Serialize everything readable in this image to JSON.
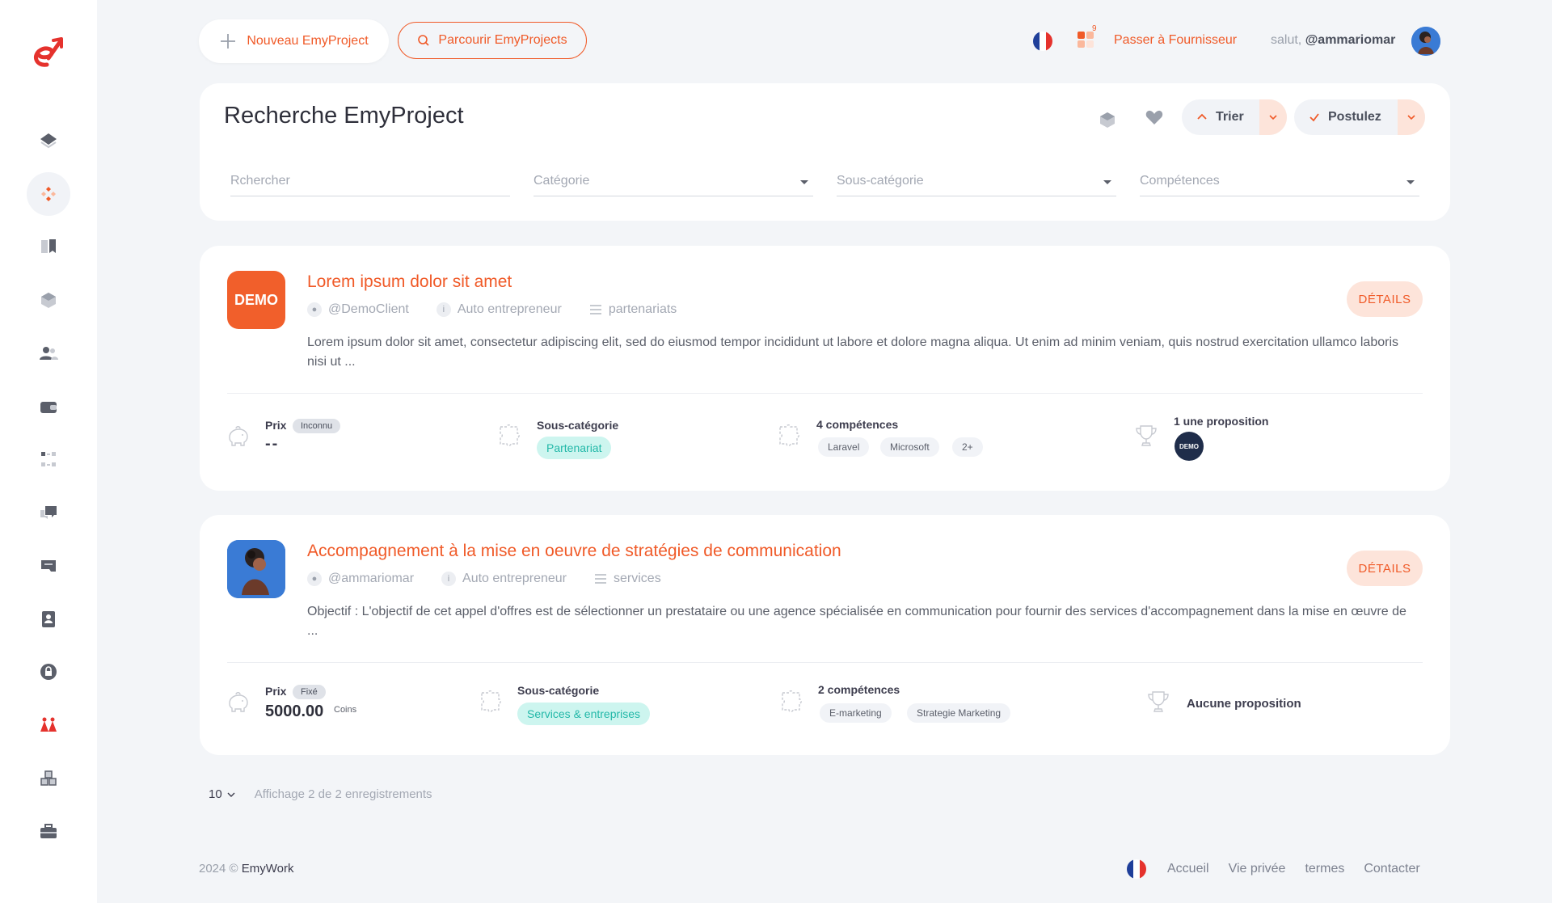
{
  "topbar": {
    "new_project": "Nouveau EmyProject",
    "browse_projects": "Parcourir EmyProjects",
    "notif_count": "9",
    "switch_link": "Passer à Fournisseur",
    "greeting": "salut,",
    "username": "@ammariomar"
  },
  "search": {
    "title": "Recherche EmyProject",
    "sort_label": "Trier",
    "apply_label": "Postulez",
    "search_placeholder": "Rchercher",
    "category_placeholder": "Catégorie",
    "subcategory_placeholder": "Sous-catégorie",
    "skills_placeholder": "Compétences"
  },
  "projects": [
    {
      "logo_text": "DEMO",
      "title": "Lorem ipsum dolor sit amet",
      "client": "@DemoClient",
      "client_type": "Auto entrepreneur",
      "category": "partenariats",
      "description": "Lorem ipsum dolor sit amet, consectetur adipiscing elit, sed do eiusmod tempor incididunt ut labore et dolore magna aliqua. Ut enim ad minim veniam, quis nostrud exercitation ullamco laboris nisi ut ...",
      "details_label": "DÉTAILS",
      "price_label": "Prix",
      "price_badge": "Inconnu",
      "price_value": "--",
      "subcategory_label": "Sous-catégorie",
      "subcategory_value": "Partenariat",
      "skills_label": "4 compétences",
      "skills": [
        "Laravel",
        "Microsoft",
        "2+"
      ],
      "proposals_label": "1 une proposition",
      "proposal_avatar": "DEMO"
    },
    {
      "title": "Accompagnement à la mise en oeuvre de stratégies de communication",
      "client": "@ammariomar",
      "client_type": "Auto entrepreneur",
      "category": "services",
      "description": "Objectif : L'objectif de cet appel d'offres est de sélectionner un prestataire ou une agence spécialisée en communication pour fournir des services d'accompagnement dans la mise en œuvre de ...",
      "details_label": "DÉTAILS",
      "price_label": "Prix",
      "price_badge": "Fixé",
      "price_value": "5000.00",
      "price_unit": "Coins",
      "subcategory_label": "Sous-catégorie",
      "subcategory_value": "Services & entreprises",
      "skills_label": "2 compétences",
      "skills": [
        "E-marketing",
        "Strategie Marketing"
      ],
      "proposals_label": "Aucune proposition"
    }
  ],
  "pagination": {
    "page_size": "10",
    "info": "Affichage 2 de 2 enregistrements"
  },
  "footer": {
    "copyright": "2024 ©",
    "brand": "EmyWork",
    "links": [
      "Accueil",
      "Vie privée",
      "termes",
      "Contacter"
    ]
  },
  "colors": {
    "accent": "#f05a28",
    "accent_soft": "#fde4da",
    "teal_tag_bg": "#cdf5ef",
    "teal_tag_text": "#22b8a8",
    "background": "#f3f5f8"
  },
  "icons": {
    "sidebar": [
      "layers-icon",
      "apps-icon",
      "book-icon",
      "cube-icon",
      "users-icon",
      "wallet-icon",
      "grid-dots-icon",
      "chat-icon",
      "inbox-icon",
      "contact-icon",
      "lock-icon",
      "community-icon",
      "boxes-icon",
      "briefcase-icon"
    ]
  }
}
